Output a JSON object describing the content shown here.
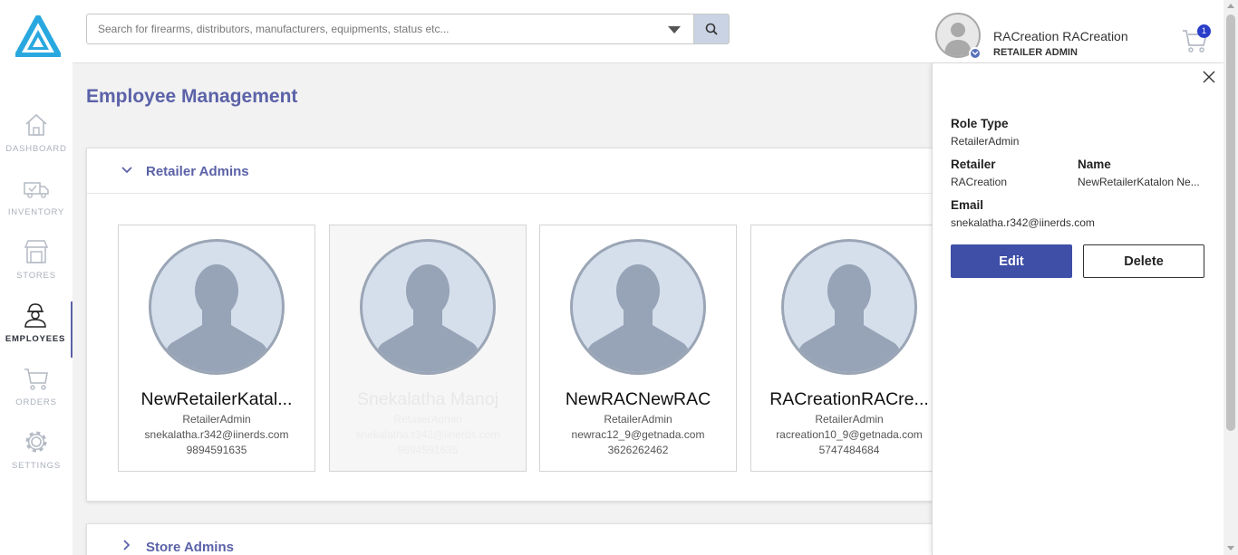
{
  "sidebar": {
    "items": [
      {
        "label": "DASHBOARD",
        "icon": "home-icon"
      },
      {
        "label": "INVENTORY",
        "icon": "truck-icon"
      },
      {
        "label": "STORES",
        "icon": "store-icon"
      },
      {
        "label": "EMPLOYEES",
        "icon": "employee-icon",
        "active": true
      },
      {
        "label": "ORDERS",
        "icon": "cart-icon"
      },
      {
        "label": "SETTINGS",
        "icon": "gear-icon"
      }
    ]
  },
  "header": {
    "search_placeholder": "Search for firearms, distributors, manufacturers, equipments, status etc...",
    "user_name": "RACreation RACreation",
    "user_role": "RETAILER ADMIN",
    "cart_count": "1"
  },
  "main": {
    "title": "Employee Management",
    "sections": [
      {
        "label": "Retailer Admins",
        "expanded": true
      },
      {
        "label": "Store Admins",
        "expanded": false
      }
    ],
    "employees": [
      {
        "name": "NewRetailerKatal...",
        "role": "RetailerAdmin",
        "email": "snekalatha.r342@iinerds.com",
        "phone": "9894591635"
      },
      {
        "name": "Snekalatha Manoj",
        "role": "RetailerAdmin",
        "email": "snekalatha.r342@iinerds.com",
        "phone": "9894591635",
        "faded": true
      },
      {
        "name": "NewRACNewRAC",
        "role": "RetailerAdmin",
        "email": "newrac12_9@getnada.com",
        "phone": "3626262462"
      },
      {
        "name": "RACreationRACre...",
        "role": "RetailerAdmin",
        "email": "racreation10_9@getnada.com",
        "phone": "5747484684"
      }
    ]
  },
  "panel": {
    "role_type_label": "Role Type",
    "role_type_value": "RetailerAdmin",
    "retailer_label": "Retailer",
    "retailer_value": "RACreation",
    "name_label": "Name",
    "name_value": "NewRetailerKatalon Ne...",
    "email_label": "Email",
    "email_value": "snekalatha.r342@iinerds.com",
    "edit_label": "Edit",
    "delete_label": "Delete"
  },
  "colors": {
    "accent": "#5b62a8",
    "edit_button": "#3f4ea6",
    "logo": "#29a8e0",
    "cart_badge": "#2b3ec9"
  }
}
